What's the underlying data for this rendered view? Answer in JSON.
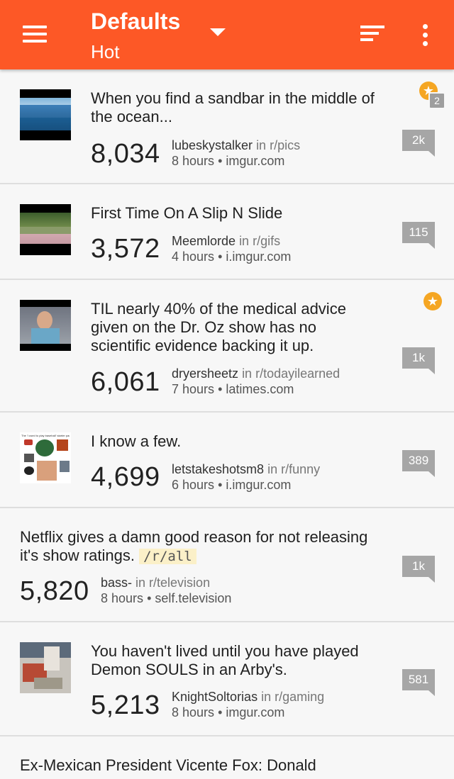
{
  "header": {
    "title": "Defaults",
    "subtitle": "Hot"
  },
  "accent_color": "#fd5826",
  "posts": [
    {
      "title": "When you find a sandbar in the middle of the ocean...",
      "score": "8,034",
      "author": "lubeskystalker",
      "subreddit": "in r/pics",
      "age": "8 hours",
      "domain": "imgur.com",
      "comments": "2k",
      "gilded": true,
      "gild_count": "2"
    },
    {
      "title": "First Time On A Slip N Slide",
      "score": "3,572",
      "author": "Meemlorde",
      "subreddit": "in r/gifs",
      "age": "4 hours",
      "domain": "i.imgur.com",
      "comments": "115",
      "gilded": false
    },
    {
      "title": "TIL nearly 40% of the medical advice given on the Dr. Oz show has no scientific evidence backing it up.",
      "score": "6,061",
      "author": "dryersheetz",
      "subreddit": "in r/todayilearned",
      "age": "7 hours",
      "domain": "latimes.com",
      "comments": "1k",
      "gilded": true
    },
    {
      "title": "I know a few.",
      "score": "4,699",
      "author": "letstakeshotsm8",
      "subreddit": "in r/funny",
      "age": "6 hours",
      "domain": "i.imgur.com",
      "comments": "389",
      "gilded": false
    },
    {
      "title": "Netflix gives a damn good reason for not releasing it's show ratings.",
      "tag": "/r/all",
      "score": "5,820",
      "author": "bass-",
      "subreddit": "in r/television",
      "age": "8 hours",
      "domain": "self.television",
      "comments": "1k",
      "gilded": false
    },
    {
      "title": "You haven't lived until you have played Demon SOULS in an Arby's.",
      "score": "5,213",
      "author": "KnightSoltorias",
      "subreddit": "in r/gaming",
      "age": "8 hours",
      "domain": "imgur.com",
      "comments": "581",
      "gilded": false
    },
    {
      "title": "Ex-Mexican President Vicente Fox: Donald"
    }
  ],
  "thumb_texts": {
    "starter_pack": "The 'I used to play baseball' starter pack"
  },
  "dot": "•",
  "icons": {
    "menu": "menu-icon",
    "dropdown": "chevron-down-icon",
    "sort": "sort-icon",
    "more": "more-vertical-icon",
    "gild": "star-icon"
  }
}
